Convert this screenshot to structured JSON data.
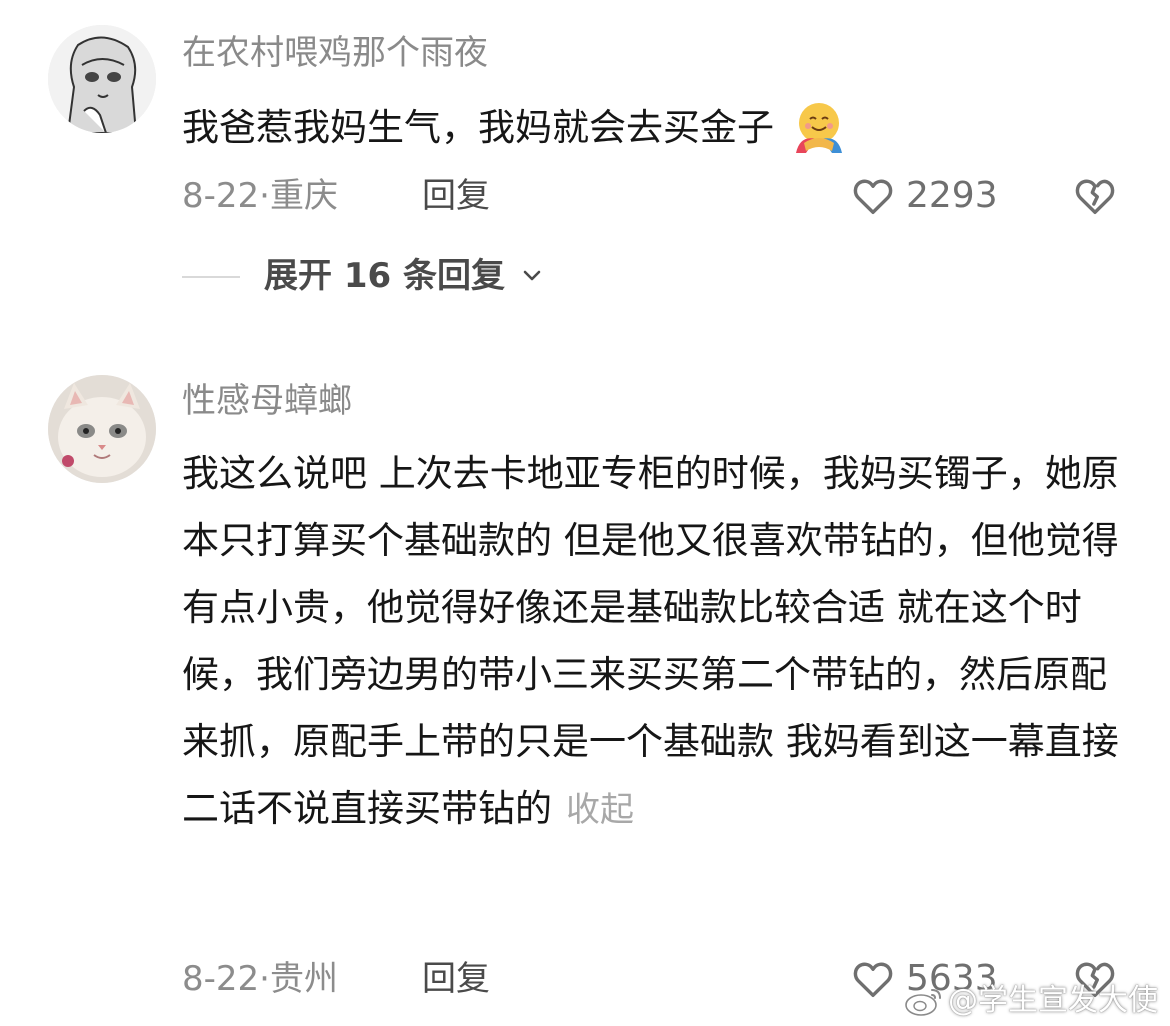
{
  "comments": [
    {
      "username": "在农村喂鸡那个雨夜",
      "text": "我爸惹我妈生气，我妈就会去买金子",
      "emoji": "hugging-face-emoji",
      "date": "8-22",
      "separator": "·",
      "location": "重庆",
      "reply_label": "回复",
      "likes": "2293",
      "expand_replies": "展开 16 条回复"
    },
    {
      "username": "性感母蟑螂",
      "text": "我这么说吧 上次去卡地亚专柜的时候，我妈买镯子，她原本只打算买个基础款的 但是他又很喜欢带钻的，但他觉得有点小贵，他觉得好像还是基础款比较合适 就在这个时候，我们旁边男的带小三来买买第二个带钻的，然后原配来抓，原配手上带的只是一个基础款 我妈看到这一幕直接二话不说直接买带钻的",
      "collapse_label": "收起",
      "date": "8-22",
      "separator": "·",
      "location": "贵州",
      "reply_label": "回复",
      "likes": "5633"
    }
  ],
  "watermark": "@学生宣发大使",
  "icons": [
    "heart-outline-icon",
    "broken-heart-icon",
    "chevron-down-icon",
    "weibo-logo-icon"
  ]
}
